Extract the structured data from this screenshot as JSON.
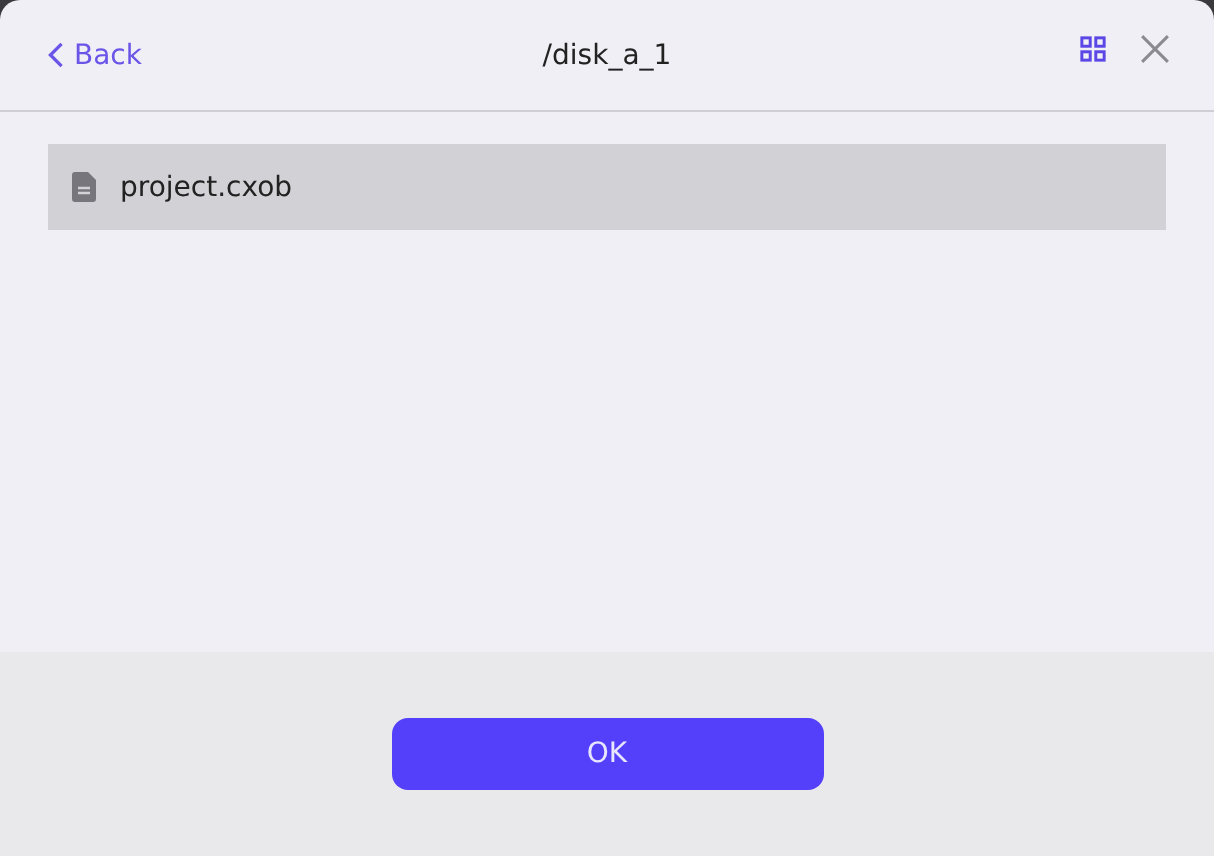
{
  "header": {
    "back": "Back",
    "title": "/disk_a_1"
  },
  "files": [
    {
      "name": "project.cxob",
      "selected": true
    }
  ],
  "buttons": [
    "OK"
  ]
}
